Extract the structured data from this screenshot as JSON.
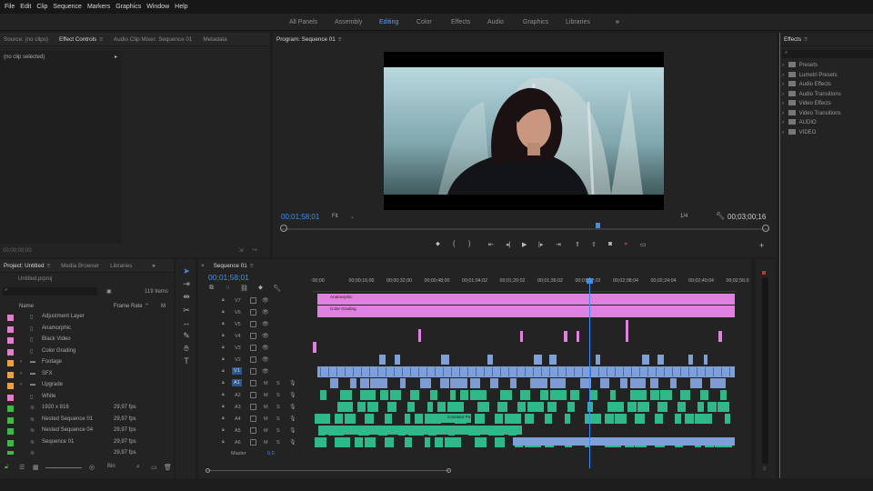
{
  "menu": [
    "File",
    "Edit",
    "Clip",
    "Sequence",
    "Markers",
    "Graphics",
    "Window",
    "Help"
  ],
  "workspaces": {
    "items": [
      "All Panels",
      "Assembly",
      "Editing",
      "Color",
      "Effects",
      "Audio",
      "Graphics",
      "Libraries"
    ],
    "active": "Editing",
    "more": "»"
  },
  "source_panel": {
    "tabs": [
      "Source: (no clips)",
      "Effect Controls",
      "Audio Clip Mixer: Sequence 01",
      "Metadata"
    ],
    "active": "Effect Controls",
    "no_clip": "(no clip selected)",
    "timecode": "00;00;00;00"
  },
  "program": {
    "title": "Program: Sequence 01",
    "timecode": "00;01;58;01",
    "fit": "Fit",
    "resolution": "1/4",
    "duration": "00;03;00;16"
  },
  "effects": {
    "tab": "Effects",
    "items": [
      "Presets",
      "Lumetri Presets",
      "Audio Effects",
      "Audio Transitions",
      "Video Effects",
      "Video Transitions",
      "AUDIO",
      "VIDEO"
    ]
  },
  "project": {
    "tabs": [
      "Project: Untitled",
      "Media Browser",
      "Libraries"
    ],
    "file": "Untitled.prproj",
    "count": "119 Items",
    "col_name": "Name",
    "col_rate": "Frame Rate",
    "rows": [
      {
        "name": "Adjustment Layer",
        "rate": "",
        "color": "#e080c8",
        "type": "item"
      },
      {
        "name": "Anamorphic",
        "rate": "",
        "color": "#e080c8",
        "type": "item"
      },
      {
        "name": "Black Video",
        "rate": "",
        "color": "#e080c8",
        "type": "item"
      },
      {
        "name": "Color Grading",
        "rate": "",
        "color": "#e080c8",
        "type": "item"
      },
      {
        "name": "Footage",
        "rate": "",
        "color": "#e8a33c",
        "type": "folder"
      },
      {
        "name": "SFX",
        "rate": "",
        "color": "#e8a33c",
        "type": "folder"
      },
      {
        "name": "Upgrade",
        "rate": "",
        "color": "#e8a33c",
        "type": "folder"
      },
      {
        "name": "White",
        "rate": "",
        "color": "#e080c8",
        "type": "item"
      },
      {
        "name": "1920 x 816",
        "rate": "29,97 fps",
        "color": "#3fb84a",
        "type": "seq"
      },
      {
        "name": "Nested Sequence 01",
        "rate": "29,97 fps",
        "color": "#3fb84a",
        "type": "seq"
      },
      {
        "name": "Nested Sequence 04",
        "rate": "29,97 fps",
        "color": "#3fb84a",
        "type": "seq"
      },
      {
        "name": "Sequence 01",
        "rate": "29,97 fps",
        "color": "#3fb84a",
        "type": "seq"
      },
      {
        "name": "",
        "rate": "29,97 fps",
        "color": "#3fb84a",
        "type": "seq"
      }
    ]
  },
  "timeline": {
    "tab": "Sequence 01",
    "timecode": "00;01;58;01",
    "ruler": [
      ":00;00",
      "00;00;16;00",
      "00;00;32;00",
      "00;00;48;00",
      "00;01;04;02",
      "00;01;20;02",
      "00;01;36;02",
      "00;01;52;02",
      "00;02;08;04",
      "00;02;24;04",
      "00;02;40;04",
      "00;02;56;0"
    ],
    "video_tracks": [
      "V7",
      "V6",
      "V5",
      "V4",
      "V3",
      "V2",
      "V1"
    ],
    "audio_tracks": [
      "A1",
      "A2",
      "A3",
      "A4",
      "A5",
      "A6"
    ],
    "master": "Master",
    "master_val": "0,0",
    "clip_labels": [
      "Anamorphic",
      "Color Grading",
      "Constant Po"
    ]
  },
  "colors": {
    "accent": "#3c8ef5",
    "pink": "#e080e0",
    "video_clip": "#7ea0d8",
    "audio_clip": "#2fb88a"
  }
}
